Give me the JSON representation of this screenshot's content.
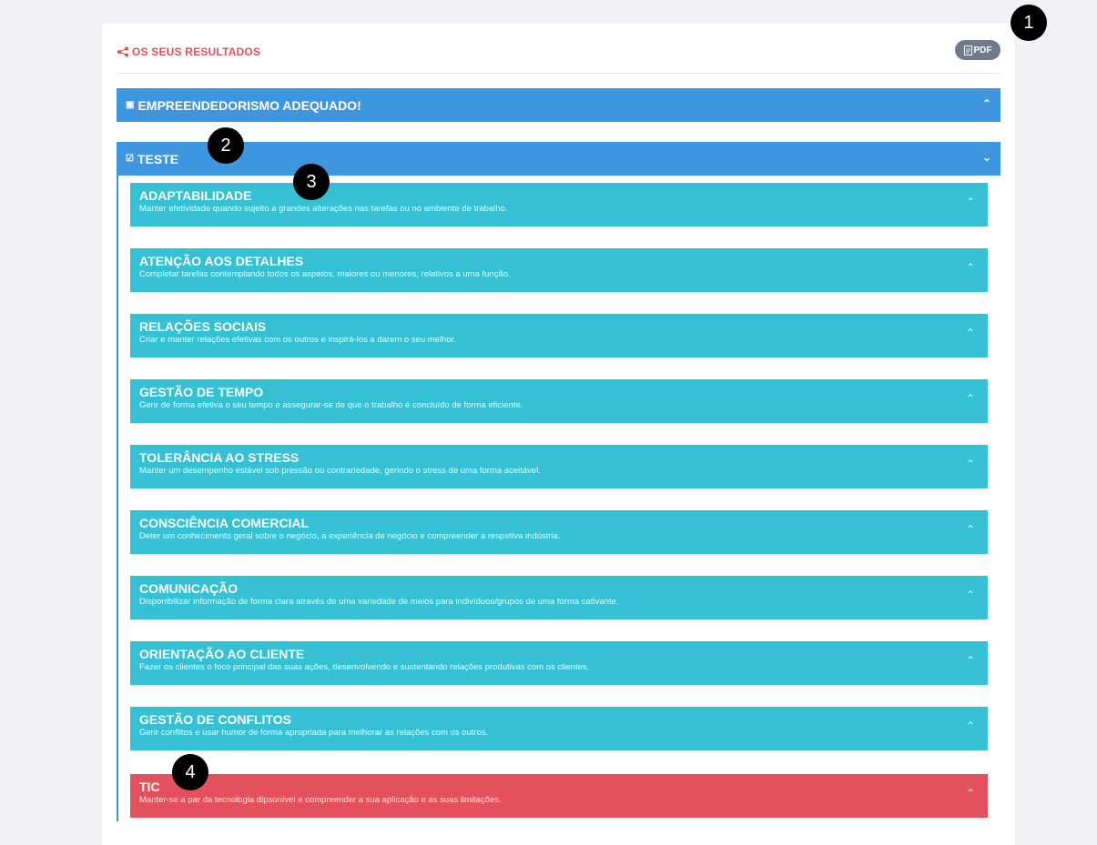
{
  "header": {
    "title": "OS SEUS RESULTADOS",
    "share_icon": "share-icon",
    "pdf_label": "PDF",
    "pdf_icon": "pdf-icon"
  },
  "sections": [
    {
      "icon": "briefcase-icon",
      "title": "EMPREENDEDORISMO ADEQUADO!",
      "chevron": "chevron-up-icon"
    },
    {
      "icon": "checklist-icon",
      "title": "TESTE",
      "chevron": "chevron-down-icon"
    }
  ],
  "skills": [
    {
      "title": "ADAPTABILIDADE",
      "description": "Manter efetividade quando sujeito a grandes alterações nas tarefas ou no ambiente de trabalho.",
      "color": "#35c1d3"
    },
    {
      "title": "ATENÇÃO AOS DETALHES",
      "description": "Completar tarefas contemplando todos os aspetos, maiores ou menores, relativos a uma função.",
      "color": "#35c1d3"
    },
    {
      "title": "RELAÇÕES SOCIAIS",
      "description": "Criar e manter relações efetivas com os outros e inspirá-los a darem o seu melhor.",
      "color": "#35c1d3"
    },
    {
      "title": "GESTÃO DE TEMPO",
      "description": "Gerir de forma efetiva o seu tempo e assegurar-se de que o trabalho é concluído de forma eficiente.",
      "color": "#35c1d3"
    },
    {
      "title": "TOLERÂNCIA AO STRESS",
      "description": "Manter um desempenho estável sob pressão ou contrariedade, gerindo o stress de uma forma aceitável.",
      "color": "#35c1d3"
    },
    {
      "title": "CONSCIÊNCIA COMERCIAL",
      "description": "Deter um conhecimento geral sobre o negócio, a experiência de negócio e compreender a respetiva indústria.",
      "color": "#35c1d3"
    },
    {
      "title": "COMUNICAÇÃO",
      "description": "Disponibilizar informação de forma clara através de uma variedade de meios para indivíduos/grupos de uma forma cativante.",
      "color": "#35c1d3"
    },
    {
      "title": "ORIENTAÇÃO AO CLIENTE",
      "description": "Fazer os clientes o foco principal das suas ações, desenvolvendo e sustentando relações produtivas com os clientes.",
      "color": "#35c1d3"
    },
    {
      "title": "GESTÃO DE CONFLITOS",
      "description": "Gerir conflitos e usar humor de forma apropriada para melhorar as relações com os outros.",
      "color": "#35c1d3"
    },
    {
      "title": "TIC",
      "description": "Manter-se a par da tecnologia dipsonível e compreender a sua aplicação e as suas limitações.",
      "color": "#e3515d"
    }
  ],
  "markers": [
    "1",
    "2",
    "3",
    "4"
  ]
}
